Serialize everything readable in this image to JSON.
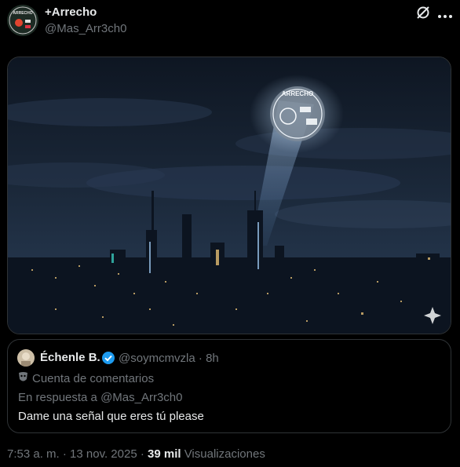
{
  "post": {
    "display_name": "+Arrecho",
    "handle": "@Mas_Arr3ch0",
    "avatar_text": "ARRECHO"
  },
  "media": {
    "spotlight_badge_text": "ARRECHO"
  },
  "quote": {
    "display_name": "Échenle B.",
    "handle_time": "@soymcmvzla · 8h",
    "label": "Cuenta de comentarios",
    "reply_to": "En respuesta a @Mas_Arr3ch0",
    "text": "Dame una señal que eres tú please"
  },
  "footer": {
    "time_date": "7:53 a. m. · 13 nov. 2025 · ",
    "views_count": "39 mil",
    "views_label": " Visualizaciones"
  },
  "colors": {
    "background": "#000000",
    "text_primary": "#e7e9ea",
    "text_secondary": "#71767b",
    "verified_blue": "#1d9bf0",
    "border": "#2f3336"
  },
  "icons": [
    "grok-icon",
    "more-icon",
    "verified-icon",
    "drama-mask-icon",
    "sparkle-icon"
  ]
}
